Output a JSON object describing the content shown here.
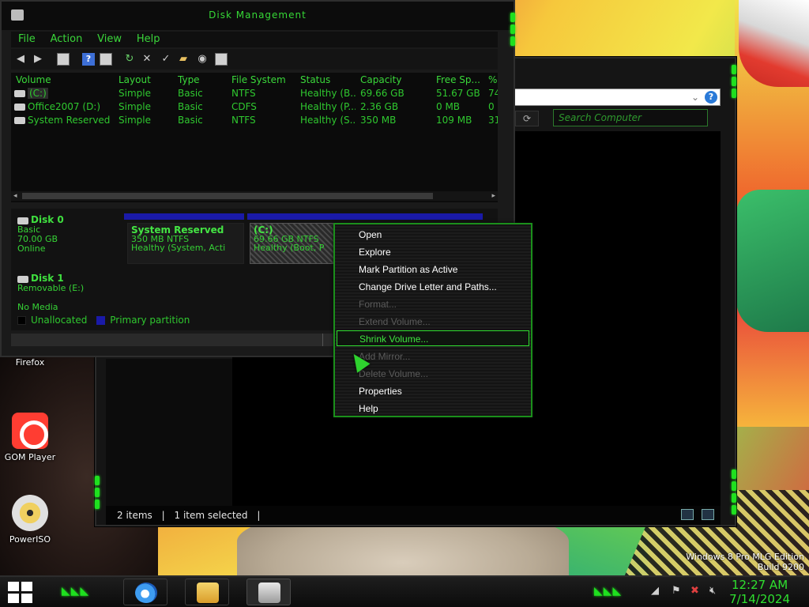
{
  "desktop": {
    "icons": [
      {
        "label": "Firefox"
      },
      {
        "label": "GOM Player"
      },
      {
        "label": "PowerISO"
      }
    ],
    "watermark": {
      "line1": "Windows 8 Pro MLG Edition",
      "line2": "Build 9200"
    }
  },
  "explorer": {
    "search_placeholder": "Search Computer",
    "help_glyph": "?",
    "status": {
      "items": "2 items",
      "selected": "1 item selected"
    }
  },
  "disk_management": {
    "title": "Disk Management",
    "menu": [
      "File",
      "Action",
      "View",
      "Help"
    ],
    "columns": [
      "Volume",
      "Layout",
      "Type",
      "File System",
      "Status",
      "Capacity",
      "Free Sp...",
      "%"
    ],
    "volumes": [
      {
        "volume": "(C:)",
        "layout": "Simple",
        "type": "Basic",
        "fs": "NTFS",
        "status": "Healthy (B...",
        "capacity": "69.66 GB",
        "free": "51.67 GB",
        "pct": "74"
      },
      {
        "volume": "Office2007 (D:)",
        "layout": "Simple",
        "type": "Basic",
        "fs": "CDFS",
        "status": "Healthy (P...",
        "capacity": "2.36 GB",
        "free": "0 MB",
        "pct": "0"
      },
      {
        "volume": "System Reserved",
        "layout": "Simple",
        "type": "Basic",
        "fs": "NTFS",
        "status": "Healthy (S...",
        "capacity": "350 MB",
        "free": "109 MB",
        "pct": "31"
      }
    ],
    "disk0": {
      "name": "Disk 0",
      "kind": "Basic",
      "size": "70.00 GB",
      "state": "Online",
      "sysres": {
        "name": "System Reserved",
        "size": "350 MB NTFS",
        "status": "Healthy (System, Acti"
      },
      "c": {
        "name": "(C:)",
        "size": "69.66 GB NTFS",
        "status": "Healthy (Boot, P"
      }
    },
    "disk1": {
      "name": "Disk 1",
      "kind": "Removable (E:)",
      "state": "No Media"
    },
    "legend": {
      "unallocated": "Unallocated",
      "primary": "Primary partition",
      "unallocated_color": "#000000",
      "primary_color": "#1a1aa8"
    }
  },
  "context_menu": {
    "items": [
      {
        "label": "Open",
        "enabled": true
      },
      {
        "label": "Explore",
        "enabled": true
      },
      {
        "label": "Mark Partition as Active",
        "enabled": true
      },
      {
        "label": "Change Drive Letter and Paths...",
        "enabled": true
      },
      {
        "label": "Format...",
        "enabled": false
      },
      {
        "label": "Extend Volume...",
        "enabled": false
      },
      {
        "label": "Shrink Volume...",
        "enabled": true,
        "highlighted": true
      },
      {
        "label": "Add Mirror...",
        "enabled": false
      },
      {
        "label": "Delete Volume...",
        "enabled": false
      },
      {
        "label": "Properties",
        "enabled": true
      },
      {
        "label": "Help",
        "enabled": true
      }
    ]
  },
  "taskbar": {
    "time": "12:27 AM",
    "date": "7/14/2024"
  },
  "colors": {
    "accent": "#37d33b",
    "highlight_border": "#2fe02f"
  }
}
